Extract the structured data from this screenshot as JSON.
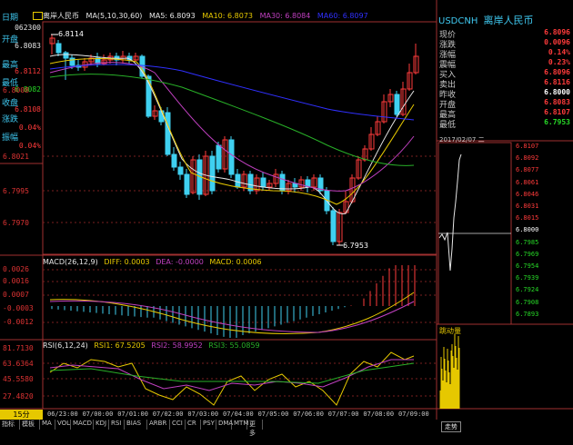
{
  "header": {
    "name": "离岸人民币",
    "ma_params": "MA(5,10,30,60)",
    "ma5": "MA5: 6.8093",
    "ma10": "MA10: 6.8073",
    "ma30": "MA30: 6.8084",
    "ma60": "MA60: 6.8097"
  },
  "left_panel": {
    "date_label": "日期",
    "time_value": "062300",
    "open_label": "开盘",
    "open_value": "6.8083",
    "high_label": "最高",
    "high_value": "6.8112",
    "low_label": "最低",
    "low_value": "6.8082",
    "close_label": "收盘",
    "close_value": "6.8108",
    "change_label": "涨跌",
    "change_value": "0.04%",
    "amp_label": "振幅",
    "amp_value": "0.04%"
  },
  "price_axis": [
    "6.8008",
    "6.8021",
    "6.7995",
    "6.7970"
  ],
  "annotations": {
    "high": "6.8114",
    "low": "6.7953"
  },
  "macd": {
    "label": "MACD(26,12,9)",
    "diff": "DIFF: 0.0003",
    "dea": "DEA: -0.0000",
    "macd": "MACD: 0.0006",
    "axis": [
      "0.0026",
      "0.0016",
      "0.0007",
      "-0.0003",
      "-0.0012"
    ]
  },
  "rsi": {
    "label": "RSI(6,12,24)",
    "rsi1": "RSI1: 67.5205",
    "rsi2": "RSI2: 58.9952",
    "rsi3": "RSI3: 55.0859",
    "axis": [
      "81.7130",
      "63.6364",
      "45.5580",
      "27.4820"
    ]
  },
  "time_axis": [
    "06/23:00",
    "07/00:00",
    "07/01:00",
    "07/02:00",
    "07/03:00",
    "07/04:00",
    "07/05:00",
    "07/06:00",
    "07/07:00",
    "07/08:00",
    "07/09:00"
  ],
  "period": "15分",
  "bottom_tabs": [
    "指标",
    "模板",
    "MA",
    "VOL",
    "MACD",
    "KDJ",
    "RSI",
    "BIAS",
    "ARBR",
    "CCI",
    "CR",
    "PSY",
    "DMA",
    "MTM",
    "更多"
  ],
  "right_panel": {
    "symbol": "USDCNH",
    "name": "离岸人民币",
    "rows": [
      {
        "label": "现价",
        "value": "6.8096",
        "color": "#ff3b3b"
      },
      {
        "label": "涨跌",
        "value": "0.0096",
        "color": "#ff3b3b"
      },
      {
        "label": "涨幅",
        "value": "0.14%",
        "color": "#ff3b3b"
      },
      {
        "label": "震幅",
        "value": "0.23%",
        "color": "#ff3b3b"
      },
      {
        "label": "买入",
        "value": "6.8096",
        "color": "#ff3b3b"
      },
      {
        "label": "卖出",
        "value": "6.8116",
        "color": "#ff3b3b"
      },
      {
        "label": "昨收",
        "value": "6.8000",
        "color": "#ffffff"
      },
      {
        "label": "开盘",
        "value": "6.8083",
        "color": "#ff3b3b"
      },
      {
        "label": "最高",
        "value": "6.8107",
        "color": "#ff3b3b"
      },
      {
        "label": "最低",
        "value": "6.7953",
        "color": "#27d827"
      }
    ],
    "mini_date": "2017/02/07 二",
    "mini_axis": [
      "6.8107",
      "6.8092",
      "6.8077",
      "6.8061",
      "6.8046",
      "6.8031",
      "6.8015",
      "6.8000",
      "6.7985",
      "6.7969",
      "6.7954",
      "6.7939",
      "6.7924",
      "6.7908",
      "6.7893"
    ],
    "tick_label": "跳动量",
    "tick_tab": "走势"
  },
  "colors": {
    "up": "#ff3b3b",
    "down": "#3fd0f0",
    "ma5": "#e6e6e6",
    "ma10": "#e6c800",
    "ma30": "#c040c0",
    "ma60": "#3030ff",
    "ma_green": "#28b028"
  }
}
